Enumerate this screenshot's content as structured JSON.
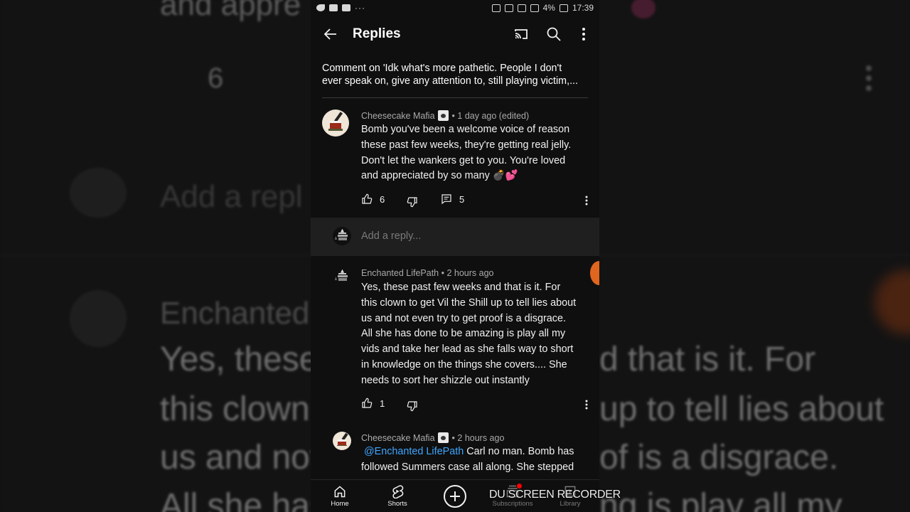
{
  "background_zoom": {
    "line1": "and appre",
    "count": "6",
    "add_reply": "Add a repl",
    "author": "Enchanted L",
    "row_a_left": "Yes, these",
    "row_a_right": "d that is it. For",
    "row_b_left": "this clown",
    "row_b_right": "up to tell lies about",
    "row_c_left": "us and not",
    "row_c_right": "of is a disgrace.",
    "row_d_left": "All she has",
    "row_d_right": "ng is play all my"
  },
  "status_bar": {
    "battery": "4%",
    "time": "17:39",
    "more": "···"
  },
  "appbar": {
    "title": "Replies"
  },
  "context": {
    "line1": "Comment on 'Idk what's more pathetic. People I don't",
    "line2": "ever speak on, give any attention to, still playing victim,..."
  },
  "comments": [
    {
      "author": "Cheesecake Mafia",
      "time": "1 day ago (edited)",
      "lines": [
        "Bomb you've been a welcome voice of reason",
        "these past few weeks, they're getting real jelly.",
        "Don't let the wankers get to you. You're loved",
        "and appreciated by so many 💣💕"
      ],
      "likes": "6",
      "replies": "5"
    },
    {
      "author": "Enchanted LifePath",
      "time": "2 hours ago",
      "lines": [
        "Yes, these past few weeks and that is it. For",
        "this clown to get Vil the Shill up to tell lies about",
        "us and not even try to get proof is a disgrace.",
        "All she has done to be amazing is play all my",
        "vids and take her lead as she falls way to short",
        "in knowledge on the things she covers.... She",
        "needs to sort her shizzle out instantly"
      ],
      "likes": "1"
    },
    {
      "author": "Cheesecake Mafia",
      "time": "2 hours ago",
      "mention": "@Enchanted LifePath",
      "line1_rest": " Carl no man. Bomb has",
      "line2": "followed Summers case all along. She stepped"
    }
  ],
  "reply_input": {
    "placeholder": "Add a reply..."
  },
  "nav": {
    "home": "Home",
    "shorts": "Shorts",
    "subscriptions": "Subscriptions",
    "library": "Library"
  },
  "watermark": "DU SCREEN RECORDER",
  "colors": {
    "background": "#0f0f0f",
    "mention": "#3ea6ff",
    "reply_bar": "#1f1f1f",
    "accent_orange": "#e0651e",
    "notification_red": "#ff0000"
  }
}
